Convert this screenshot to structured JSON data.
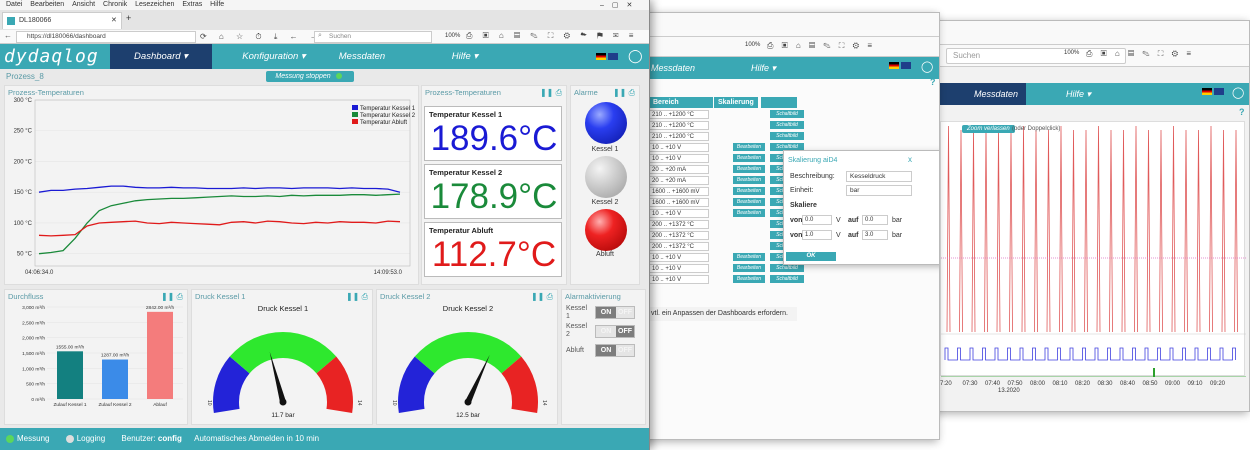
{
  "browser": {
    "menu": [
      "Datei",
      "Bearbeiten",
      "Ansicht",
      "Chronik",
      "Lesezeichen",
      "Extras",
      "Hilfe"
    ],
    "tab_title": "DL180066",
    "url": "https://dl180066/dashboard",
    "search_placeholder": "Suchen",
    "zoom": "100%"
  },
  "app": {
    "logo": "dydaqlog",
    "nav": [
      "Dashboard ▾",
      "Konfiguration ▾",
      "Messdaten",
      "Hilfe ▾"
    ],
    "process_label": "Prozess_8",
    "stop_button": "Messung stoppen"
  },
  "panels": {
    "temp_chart": "Prozess-Temperaturen",
    "temp_values": "Prozess-Temperaturen",
    "alarms": "Alarme",
    "flow": "Durchfluss",
    "pressure1": "Druck Kessel 1",
    "pressure2": "Druck Kessel 2",
    "alarm_activation": "Alarmaktivierung"
  },
  "temps": [
    {
      "label": "Temperatur Kessel 1",
      "value": "189.6°C",
      "color": "#1a1ad4"
    },
    {
      "label": "Temperatur Kessel 2",
      "value": "178.9°C",
      "color": "#1a8a3a"
    },
    {
      "label": "Temperatur Abluft",
      "value": "112.7°C",
      "color": "#e01a1a"
    }
  ],
  "alarms": [
    "Kessel 1",
    "Kessel 2",
    "Abluft"
  ],
  "gauges": [
    {
      "title": "Druck Kessel 1",
      "value": "11.7 bar",
      "min": "10",
      "max": "14"
    },
    {
      "title": "Druck Kessel 2",
      "value": "12.5 bar",
      "min": "10",
      "max": "14"
    }
  ],
  "toggles": [
    {
      "label": "Kessel 1",
      "on": "ON",
      "off": "OFF",
      "state": "on"
    },
    {
      "label": "Kessel 2",
      "on": "ON",
      "off": "OFF",
      "state": "off"
    },
    {
      "label": "Abluft",
      "on": "ON",
      "off": "OFF",
      "state": "on"
    }
  ],
  "status": {
    "measure": "Messung",
    "logging": "Logging",
    "user_label": "Benutzer:",
    "user": "config",
    "logout": "Automatisches Abmelden in 10 min"
  },
  "chart_data": [
    {
      "type": "line",
      "title": "Prozess-Temperaturen",
      "x_start": "04:06:34.0",
      "x_end": "14:09:53.0",
      "yticks": [
        "300 °C",
        "250 °C",
        "200 °C",
        "150 °C",
        "100 °C",
        "50 °C"
      ],
      "ylim": [
        30,
        300
      ],
      "legend": "top-right",
      "series": [
        {
          "name": "Temperatur Kessel 1",
          "color": "#1a1ad4",
          "values": [
            150,
            153,
            153,
            155,
            156,
            158,
            160,
            160,
            158,
            157,
            157,
            158,
            157,
            157,
            156,
            156,
            156,
            157,
            156,
            157,
            157,
            156,
            157,
            157,
            157,
            156,
            157,
            156,
            156,
            155,
            150
          ]
        },
        {
          "name": "Temperatur Kessel 2",
          "color": "#1a8a3a",
          "values": [
            50,
            52,
            55,
            75,
            100,
            120,
            128,
            132,
            136,
            138,
            139,
            140,
            140,
            141,
            142,
            143,
            144,
            143,
            143,
            144,
            143,
            145,
            144,
            145,
            145,
            145,
            146,
            146,
            145,
            146,
            147
          ]
        },
        {
          "name": "Temperatur Abluft",
          "color": "#e01a1a",
          "values": [
            80,
            79,
            80,
            81,
            95,
            100,
            101,
            102,
            103,
            100,
            99,
            101,
            100,
            99,
            98,
            97,
            101,
            102,
            100,
            103,
            102,
            100,
            99,
            101,
            100,
            102,
            101,
            101,
            100,
            103,
            102
          ]
        }
      ]
    },
    {
      "type": "bar",
      "title": "Durchfluss",
      "categories": [
        "Zulauf Kessel 1",
        "Zulauf Kessel 2",
        "Ablauf"
      ],
      "values": [
        1555,
        1287,
        2842
      ],
      "labels": [
        "1555.00 m³/h",
        "1287.00 m³/h",
        "2842.00 m³/h"
      ],
      "colors": [
        "#138080",
        "#3b8be8",
        "#f47c7c"
      ],
      "yticks": [
        "3,000 m³/h",
        "2,500 m³/h",
        "2,000 m³/h",
        "1,500 m³/h",
        "1,000 m³/h",
        "500 m³/h",
        "0 m³/h"
      ],
      "ylim": [
        0,
        3000
      ]
    }
  ],
  "background_windows": {
    "dialog": {
      "title": "Skalierung aiD4",
      "close": "x",
      "desc_label": "Beschreibung:",
      "desc_value": "Kesseldruck",
      "unit_label": "Einheit:",
      "unit_value": "bar",
      "scale_label": "Skaliere",
      "from1": "von",
      "from1_val": "0.0",
      "unit1": "V",
      "to1": "auf",
      "to1_val": "0.0",
      "unit1b": "bar",
      "from2": "von",
      "from2_val": "1.0",
      "unit2": "V",
      "to2": "auf",
      "to2_val": "3.0",
      "unit2b": "bar",
      "ok": "OK"
    },
    "config_table": {
      "header_range": "Bereich",
      "header_scale": "Skalierung",
      "rows": [
        "210 .. +1200 °C",
        "210 .. +1200 °C",
        "210 .. +1200 °C",
        "10 .. +10 V",
        "10 .. +10 V",
        "20 .. +20 mA",
        "20 .. +20 mA",
        "1600 .. +1600 mV",
        "1600 .. +1600 mV",
        "10 .. +10 V",
        "200 .. +1372 °C",
        "200 .. +1372 °C",
        "200 .. +1372 °C",
        "10 .. +10 V",
        "10 .. +10 V",
        "10 .. +10 V"
      ],
      "btn_edit": "Bearbeiten",
      "btn_switch": "Schaltbild",
      "note": "vtl. ein Anpassen der Dashboards erfordern.",
      "nav": [
        "Messdaten",
        "Hilfe ▾"
      ]
    },
    "chart_window": {
      "search": "Suchen",
      "nav": [
        "Messdaten",
        "Hilfe ▾"
      ],
      "zoom_button": "Zoom verlassen",
      "zoom_hint": "(oder Doppelclick)",
      "x_ticks": [
        "7:20",
        "07:30",
        "07:40",
        "07:50",
        "08:00",
        "08:10",
        "08:20",
        "08:30",
        "08:40",
        "08:50",
        "09:00",
        "09:10",
        "09:20"
      ],
      "date": "13.2020"
    }
  }
}
